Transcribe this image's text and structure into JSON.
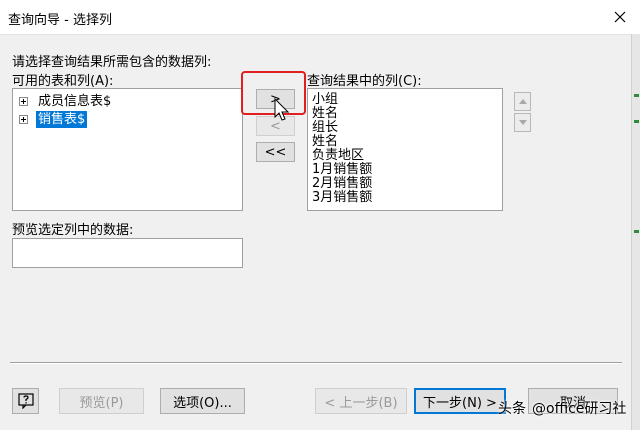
{
  "window": {
    "title": "查询向导 - 选择列"
  },
  "instruction": "请选择查询结果所需包含的数据列:",
  "available": {
    "label": "可用的表和列(A):",
    "items": [
      {
        "label": "成员信息表$",
        "selected": false
      },
      {
        "label": "销售表$",
        "selected": true
      }
    ]
  },
  "transfer": {
    "add_one": ">",
    "remove_one": "<",
    "remove_all": "<<"
  },
  "result": {
    "label": "查询结果中的列(C):",
    "columns": [
      "小组",
      "姓名",
      "组长",
      "姓名",
      "负责地区",
      "1月销售额",
      "2月销售额",
      "3月销售额"
    ]
  },
  "preview_section": {
    "label": "预览选定列中的数据:"
  },
  "buttons": {
    "preview": "预览(P)",
    "options": "选项(O)...",
    "back": "< 上一步(B)",
    "next": "下一步(N) >",
    "cancel": "取消"
  },
  "watermark": {
    "brand": "头条",
    "handle": "@office研习社"
  },
  "colors": {
    "selection": "#0078d7",
    "highlight": "#e02020"
  }
}
